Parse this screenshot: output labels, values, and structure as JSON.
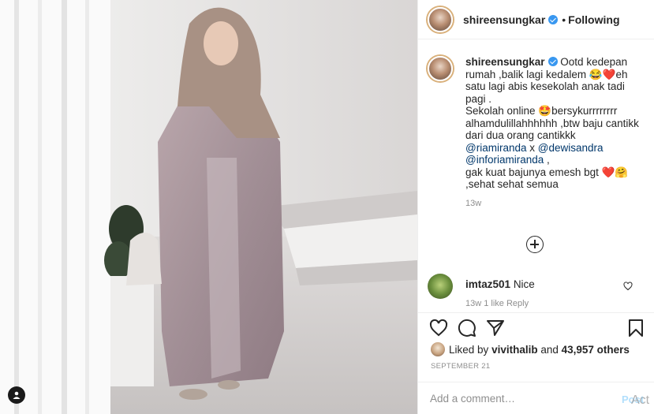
{
  "post": {
    "author": "shireensungkar",
    "follow_status": "Following",
    "separator": "•",
    "caption_author": "shireensungkar",
    "caption_parts": {
      "p1": " Ootd kedepan rumah ,balik lagi kedalem ",
      "e1": "😂❤️",
      "p2": "eh satu lagi abis kesekolah anak tadi pagi .",
      "p3": "Sekolah online ",
      "e2": "🤩",
      "p4": "bersykurrrrrrrr alhamdulillahhhhhh ,btw baju cantikk dari dua orang cantikkk",
      "m1": "@riamiranda",
      "p5": " x ",
      "m2": "@dewisandra",
      "m3": "@inforiamiranda",
      "p6": " ,",
      "p7": "gak kuat bajunya emesh bgt ",
      "e3": "❤️🤗",
      "p8": ",sehat sehat semua"
    },
    "caption_time": "13w",
    "comment": {
      "username": "imtaz501",
      "text": "Nice",
      "meta": "13w   1 like   Reply"
    },
    "liked_by_prefix": "Liked by ",
    "liked_by_user": "vivithalib",
    "liked_by_mid": " and ",
    "liked_by_count": "43,957 others",
    "date": "SEPTEMBER 21",
    "comment_placeholder": "Add a comment…",
    "post_label": "Post",
    "watermark": "Act"
  },
  "icons": {
    "like": "heart-icon",
    "comment": "comment-icon",
    "share": "share-icon",
    "save": "bookmark-icon",
    "tag": "person-tag-icon",
    "load_more": "plus-circle-icon"
  },
  "colors": {
    "text": "#262626",
    "secondary": "#8e8e8e",
    "mention": "#00376b",
    "verified": "#3897f0",
    "post_disabled": "#b2dffc",
    "border": "#efefef"
  }
}
